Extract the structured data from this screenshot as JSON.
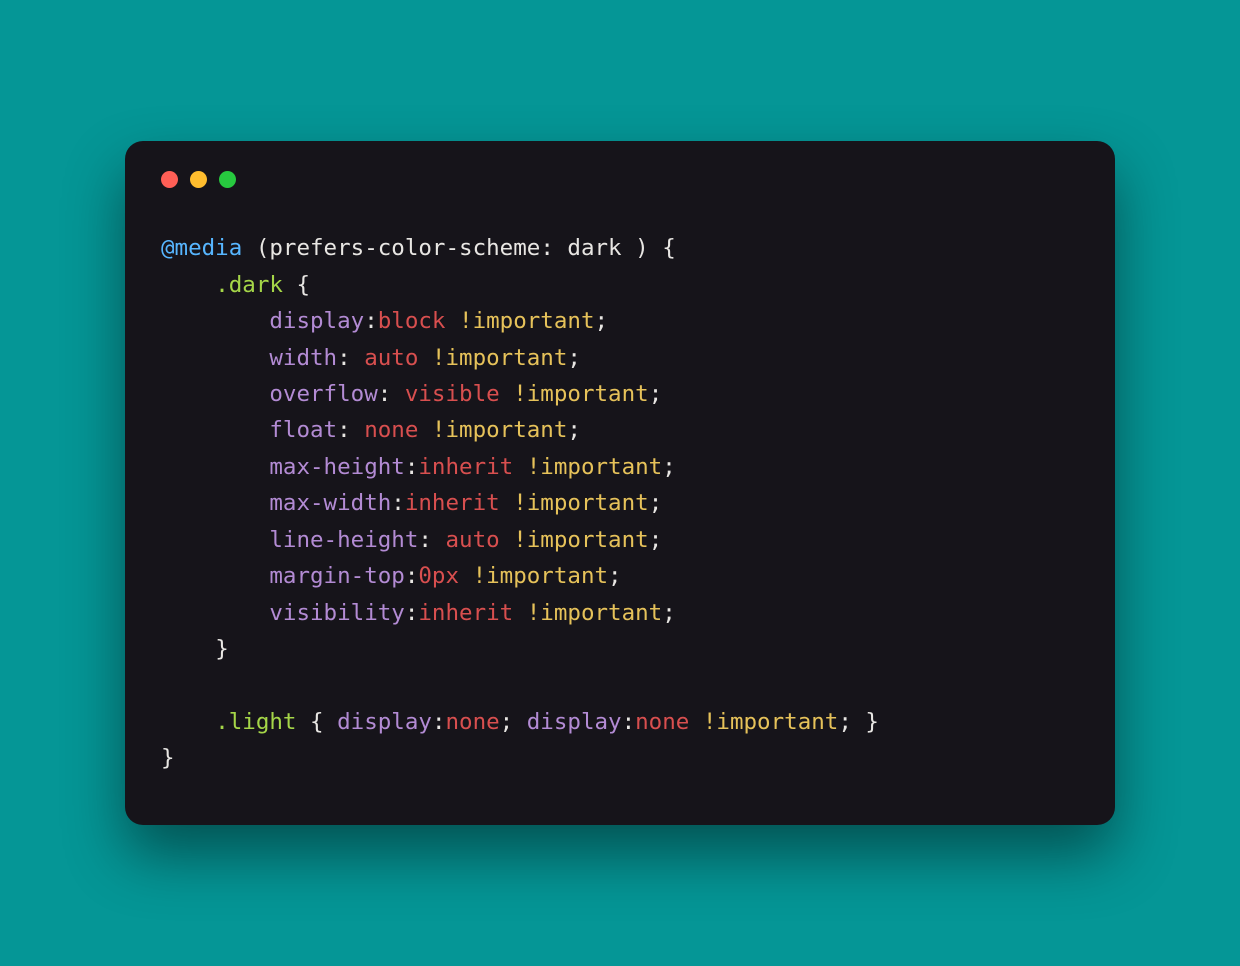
{
  "traffic_lights": {
    "red": "close-icon",
    "yellow": "minimize-icon",
    "green": "maximize-icon"
  },
  "code": {
    "l0": {
      "at": "@media",
      "open": " (",
      "pref": "prefers-color-scheme",
      "colon": ": ",
      "dark": "dark",
      "close": " ) {"
    },
    "l1": {
      "indent": "    ",
      "sel": ".dark",
      "brace": " {"
    },
    "props": [
      {
        "indent": "        ",
        "name": "display",
        "sep": ":",
        "value": "block",
        "imp": " !important",
        "semi": ";"
      },
      {
        "indent": "        ",
        "name": "width",
        "sep": ": ",
        "value": "auto",
        "imp": " !important",
        "semi": ";"
      },
      {
        "indent": "        ",
        "name": "overflow",
        "sep": ": ",
        "value": "visible",
        "imp": " !important",
        "semi": ";"
      },
      {
        "indent": "        ",
        "name": "float",
        "sep": ": ",
        "value": "none",
        "imp": " !important",
        "semi": ";"
      },
      {
        "indent": "        ",
        "name": "max-height",
        "sep": ":",
        "value": "inherit",
        "imp": " !important",
        "semi": ";"
      },
      {
        "indent": "        ",
        "name": "max-width",
        "sep": ":",
        "value": "inherit",
        "imp": " !important",
        "semi": ";"
      },
      {
        "indent": "        ",
        "name": "line-height",
        "sep": ": ",
        "value": "auto",
        "imp": " !important",
        "semi": ";"
      },
      {
        "indent": "        ",
        "name": "margin-top",
        "sep": ":",
        "value": "0px",
        "imp": " !important",
        "semi": ";"
      },
      {
        "indent": "        ",
        "name": "visibility",
        "sep": ":",
        "value": "inherit",
        "imp": " !important",
        "semi": ";"
      }
    ],
    "closeDark": {
      "indent": "    ",
      "brace": "}"
    },
    "blank": "",
    "light": {
      "indent": "    ",
      "sel": ".light",
      "open": " { ",
      "p1name": "display",
      "p1sep": ":",
      "p1val": "none",
      "p1semi": "; ",
      "p2name": "display",
      "p2sep": ":",
      "p2val": "none",
      "p2imp": " !important",
      "p2semi": ";",
      "close": " }"
    },
    "closeMedia": "}"
  }
}
